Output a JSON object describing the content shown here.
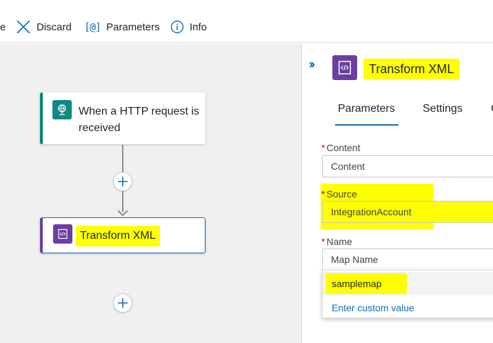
{
  "toolbar": {
    "save_fragment": "e",
    "discard_label": "Discard",
    "parameters_label": "Parameters",
    "info_label": "Info"
  },
  "canvas": {
    "trigger": {
      "title": "When a HTTP request is received",
      "icon": "http-request-icon"
    },
    "action": {
      "title": "Transform XML",
      "icon": "transform-xml-icon"
    }
  },
  "panel": {
    "title": "Transform XML",
    "tabs": [
      "Parameters",
      "Settings",
      "C"
    ],
    "active_tab": "Parameters",
    "required_marker": "*",
    "fields": {
      "content": {
        "label": "Content",
        "placeholder": "Content"
      },
      "source": {
        "label": "Source",
        "value": "IntegrationAccount"
      },
      "name": {
        "label": "Name",
        "placeholder": "Map Name"
      }
    },
    "dropdown": {
      "options": [
        "samplemap"
      ],
      "custom_option": "Enter custom value"
    }
  },
  "colors": {
    "accent": "#0f6cbd",
    "highlight": "#ffff00",
    "trigger_teal": "#008575",
    "action_purple": "#6b3fa0",
    "required_red": "#c50f1f"
  }
}
